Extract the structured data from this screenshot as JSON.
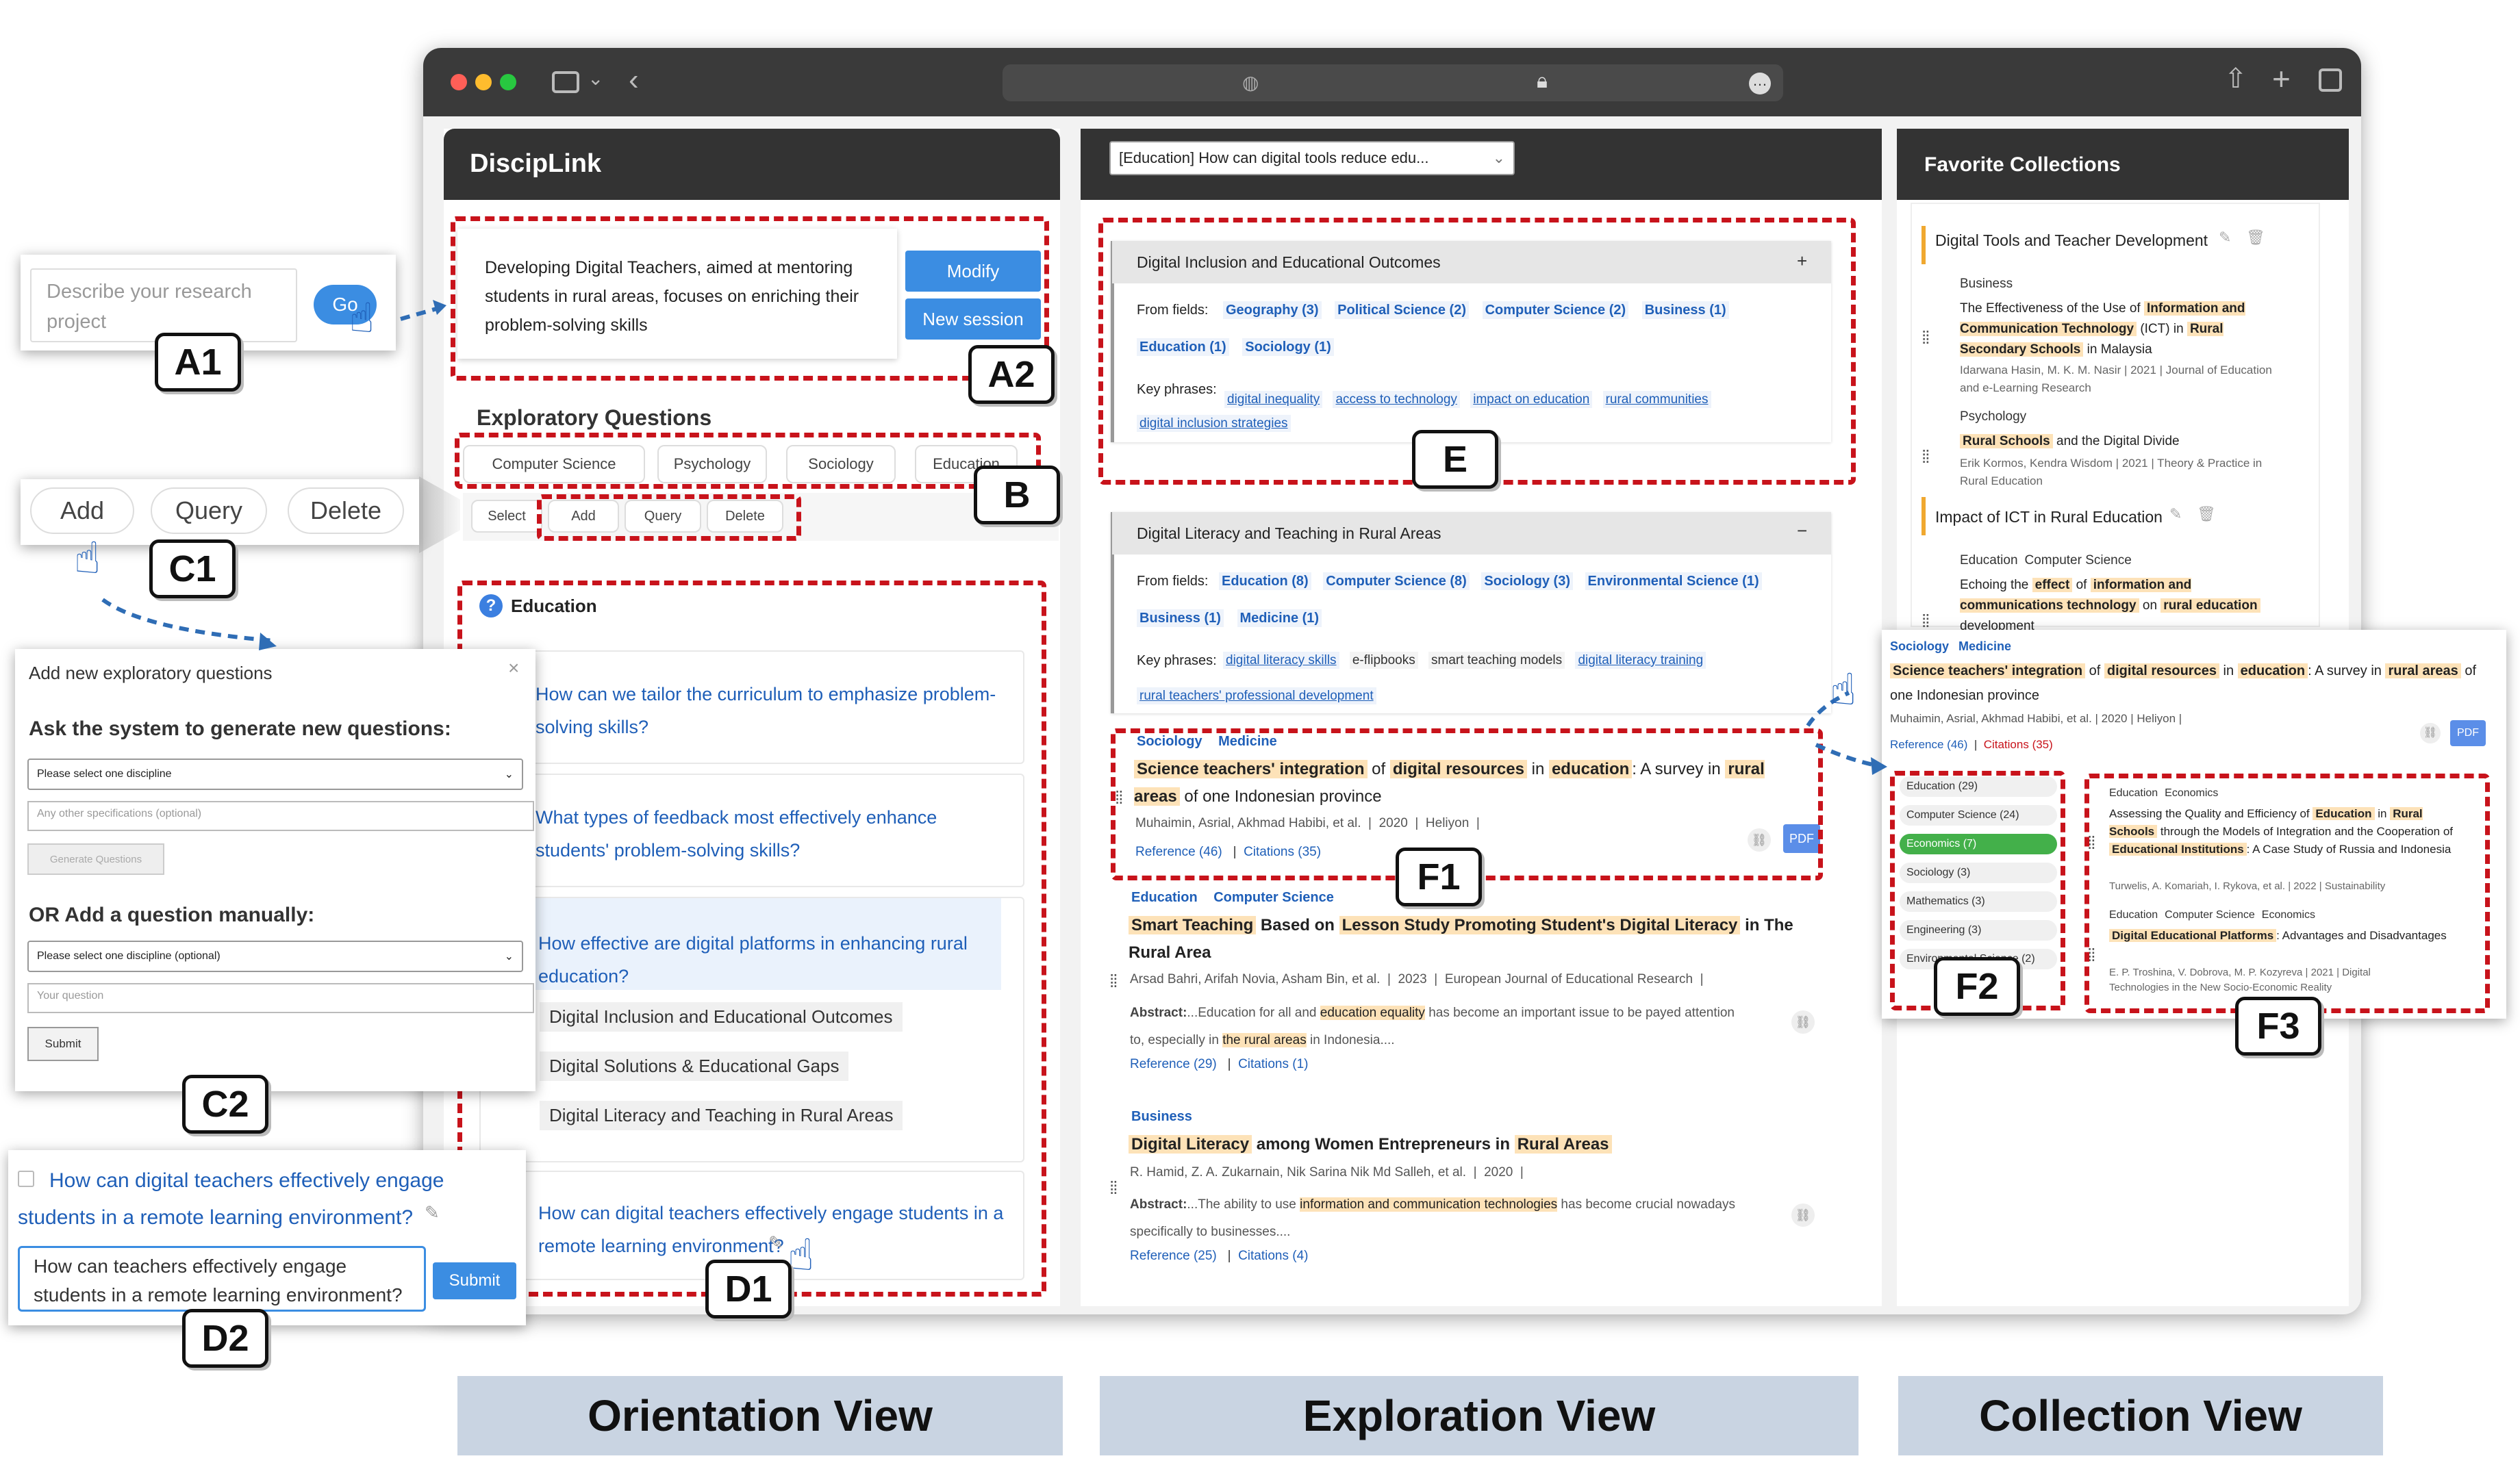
{
  "app": {
    "title": "DiscipLink"
  },
  "browser": {
    "address": ""
  },
  "A1": {
    "placeholder": "Describe your research project",
    "go": "Go"
  },
  "A2": {
    "description": "Developing Digital Teachers, aimed at mentoring students in rural areas, focuses on enriching their problem-solving skills",
    "modify": "Modify",
    "new_session": "New session"
  },
  "orientation": {
    "exploratory_title": "Exploratory Questions",
    "tabs": [
      "Computer Science",
      "Psychology",
      "Sociology",
      "Education"
    ],
    "actions": [
      "Select",
      "Add",
      "Query",
      "Delete"
    ],
    "section": "Education",
    "questions": [
      "How can we tailor the curriculum to emphasize problem-solving skills?",
      "What types of feedback most effectively enhance students' problem-solving skills?",
      "How effective are digital platforms in enhancing rural education?",
      "How can digital teachers effectively engage students in a remote learning environment?"
    ],
    "subtopics": [
      "Digital Inclusion and Educational Outcomes",
      "Digital Solutions & Educational Gaps",
      "Digital Literacy and Teaching in Rural Areas"
    ]
  },
  "C1": {
    "add": "Add",
    "query": "Query",
    "delete": "Delete"
  },
  "C2": {
    "title": "Add new exploratory questions",
    "close": "×",
    "ask_heading": "Ask the system to generate new questions:",
    "select_discipline": "Please select one discipline",
    "other_spec": "Any other specifications (optional)",
    "generate": "Generate Questions",
    "or_heading": "OR Add a question manually:",
    "select_optional": "Please select one discipline (optional)",
    "your_question": "Your question",
    "submit": "Submit"
  },
  "D2": {
    "question": "How can digital teachers effectively engage students in a remote learning environment?",
    "edit_value": "How can teachers effectively engage students in a remote learning environment?",
    "submit": "Submit"
  },
  "exploration": {
    "query_select": "[Education] How can digital tools reduce edu...",
    "topic1": {
      "title": "Digital Inclusion and Educational Outcomes",
      "toggle": "+",
      "fields_label": "From fields:",
      "fields": [
        "Geography (3)",
        "Political Science (2)",
        "Computer Science (2)",
        "Business (1)",
        "Education (1)",
        "Sociology (1)"
      ],
      "phrases_label": "Key phrases:",
      "phrases": [
        "digital inequality",
        "access to technology",
        "impact on education",
        "rural communities",
        "digital inclusion strategies"
      ]
    },
    "topic2": {
      "title": "Digital Literacy and Teaching in Rural Areas",
      "toggle": "−",
      "fields_label": "From fields:",
      "fields": [
        "Education (8)",
        "Computer Science (8)",
        "Sociology (3)",
        "Environmental Science (1)",
        "Business (1)",
        "Medicine (1)"
      ],
      "phrases_label": "Key phrases:",
      "phrases": [
        "digital literacy skills",
        "e-flipbooks",
        "smart teaching models",
        "digital literacy training",
        "rural teachers' professional development"
      ]
    },
    "paper1": {
      "tags": [
        "Sociology",
        "Medicine"
      ],
      "title_parts": [
        "Science teachers' integration",
        " of ",
        "digital resources",
        " in ",
        "education",
        ": A survey in ",
        "rural areas",
        " of one Indonesian province"
      ],
      "authors": "Muhaimin, Asrial, Akhmad Habibi, et al.",
      "year": "2020",
      "venue": "Heliyon",
      "reference": "Reference (46)",
      "citations": "Citations (35)",
      "pdf": "PDF"
    },
    "paper2": {
      "tags": [
        "Education",
        "Computer Science"
      ],
      "title_parts": [
        "Smart Teaching",
        " Based on ",
        "Lesson Study Promoting Student's Digital Literacy",
        " in The Rural Area"
      ],
      "authors": "Arsad Bahri, Arifah Novia, Asham Bin, et al.",
      "year": "2023",
      "venue": "European Journal of Educational Research",
      "abstract_label": "Abstract:",
      "abstract_parts": [
        "...Education for all and ",
        "education equality",
        " has become an important issue to be payed attention to, especially in ",
        "the rural areas",
        " in Indonesia...."
      ],
      "reference": "Reference (29)",
      "citations": "Citations (1)"
    },
    "paper3": {
      "tags": [
        "Business"
      ],
      "title_parts": [
        "Digital Literacy",
        " among Women Entrepreneurs in ",
        "Rural Areas"
      ],
      "authors": "R. Hamid, Z. A. Zukarnain, Nik Sarina Nik Md Salleh, et al.",
      "year": "2020",
      "abstract_label": "Abstract:",
      "abstract_parts": [
        "...The ability to use ",
        "information and communication technologies",
        " has become crucial nowadays specifically to businesses...."
      ],
      "reference": "Reference (25)",
      "citations": "Citations (4)"
    }
  },
  "collection": {
    "title": "Favorite Collections",
    "group1": "Digital Tools and Teacher Development",
    "c1": {
      "tag": "Business",
      "title_parts": [
        "The Effectiveness of the Use of ",
        "Information and Communication Technology",
        " (ICT) in ",
        "Rural Secondary Schools",
        " in Malaysia"
      ],
      "meta": "Idarwana Hasin, M. K. M. Nasir  |  2021  |  Journal of Education and e-Learning Research"
    },
    "c2": {
      "tag": "Psychology",
      "title_parts": [
        "Rural Schools",
        " and the Digital Divide"
      ],
      "meta": "Erik Kormos, Kendra Wisdom  |  2021  |  Theory & Practice in Rural Education"
    },
    "group2": "Impact of ICT in Rural Education",
    "c3": {
      "tags": [
        "Education",
        "Computer Science"
      ],
      "title_parts": [
        "Echoing the ",
        "effect",
        " of ",
        "information and communications technology",
        " on ",
        "rural education",
        " development"
      ]
    }
  },
  "F_popup": {
    "tags": [
      "Sociology",
      "Medicine"
    ],
    "title_parts": [
      "Science teachers' integration",
      " of ",
      "digital resources",
      " in ",
      "education",
      ": A survey in ",
      "rural areas",
      " of one Indonesian province"
    ],
    "meta": "Muhaimin, Asrial, Akhmad Habibi, et al.  |  2020  |  Heliyon  |",
    "reference": "Reference (46)",
    "citations": "Citations (35)",
    "pdf": "PDF"
  },
  "F2": {
    "fields": [
      "Education (29)",
      "Computer Science (24)",
      "Economics (7)",
      "Sociology (3)",
      "Mathematics (3)",
      "Engineering (3)",
      "Environmental Science (2)"
    ]
  },
  "F3": {
    "p1": {
      "tags": [
        "Education",
        "Economics"
      ],
      "title_parts": [
        "Assessing the Quality and Efficiency of ",
        "Education",
        " in ",
        "Rural Schools",
        " through the Models of Integration and the Cooperation of ",
        "Educational Institutions",
        ": A Case Study of Russia and Indonesia"
      ],
      "meta": "Turwelis, A. Komariah, I. Rykova, et al.  |  2022  |  Sustainability"
    },
    "p2": {
      "tags": [
        "Education",
        "Computer Science",
        "Economics"
      ],
      "title_parts": [
        "Digital Educational Platforms",
        ": Advantages and Disadvantages"
      ],
      "meta": "E. P. Troshina, V. Dobrova, M. P. Kozyreva  |  2021  |  Digital Technologies in the New Socio-Economic Reality"
    }
  },
  "labels": {
    "A1": "A1",
    "A2": "A2",
    "B": "B",
    "C1": "C1",
    "C2": "C2",
    "D1": "D1",
    "D2": "D2",
    "E": "E",
    "F1": "F1",
    "F2": "F2",
    "F3": "F3"
  },
  "views": {
    "orientation": "Orientation View",
    "exploration": "Exploration View",
    "collection": "Collection View"
  }
}
